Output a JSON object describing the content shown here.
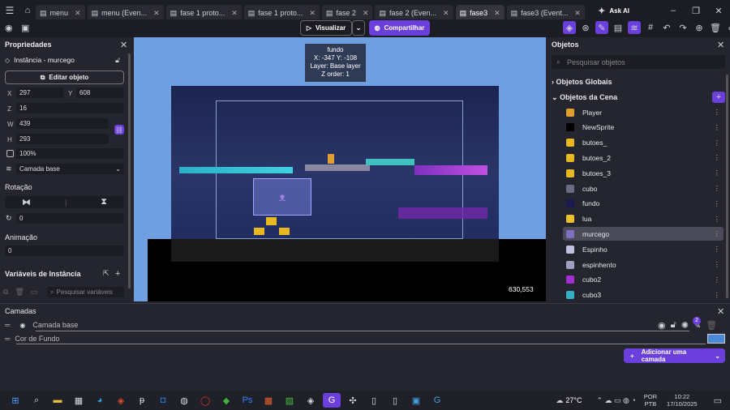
{
  "tabs": [
    {
      "label": "menu"
    },
    {
      "label": "menu (Even..."
    },
    {
      "label": "fase 1 proto..."
    },
    {
      "label": "fase 1 proto..."
    },
    {
      "label": "fase 2"
    },
    {
      "label": "fase 2 (Even..."
    },
    {
      "label": "fase3",
      "active": true
    },
    {
      "label": "fase3 (Event..."
    }
  ],
  "toolbar": {
    "preview_label": "Visualizar",
    "share_label": "Compartilhar",
    "ask_ai_label": "Ask AI"
  },
  "properties": {
    "title": "Propriedades",
    "instance_label": "Instância - murcego",
    "edit_object_label": "Editar objeto",
    "x_label": "X",
    "x": "297",
    "y_label": "Y",
    "y": "608",
    "z_label": "Z",
    "z": "16",
    "w_label": "W",
    "w": "439",
    "h_label": "H",
    "h": "293",
    "opacity": "100%",
    "layer": "Camada base",
    "rotation_label": "Rotação",
    "rotation": "0",
    "animation_label": "Animação",
    "animation": "0",
    "variables_label": "Variáveis de Instância",
    "search_vars_placeholder": "Pesquisar variáveis"
  },
  "canvas": {
    "tooltip": {
      "name": "fundo",
      "coords": "X: -347  Y: -108",
      "layer": "Layer: Base layer",
      "zorder": "Z order: 1"
    },
    "cursor_coords": "630,553"
  },
  "objects": {
    "title": "Objetos",
    "search_placeholder": "Pesquisar objetos",
    "global_label": "Objetos Globais",
    "scene_label": "Objetos da Cena",
    "items": [
      {
        "name": "Player",
        "color": "#e0a030"
      },
      {
        "name": "NewSprite",
        "color": "#000000"
      },
      {
        "name": "butoes_",
        "color": "#e8b820"
      },
      {
        "name": "butoes_2",
        "color": "#e8b820"
      },
      {
        "name": "butoes_3",
        "color": "#e8b820"
      },
      {
        "name": "cubo",
        "color": "#6a6a80"
      },
      {
        "name": "fundo",
        "color": "#1a1a50"
      },
      {
        "name": "lua",
        "color": "#e8c030"
      },
      {
        "name": "murcego",
        "color": "#8070c0",
        "selected": true
      },
      {
        "name": "Espinho",
        "color": "#c0c0e0"
      },
      {
        "name": "espinhento",
        "color": "#a0a0c0"
      },
      {
        "name": "cubo2",
        "color": "#a030d0"
      },
      {
        "name": "cubo3",
        "color": "#30b0c0"
      }
    ]
  },
  "layers": {
    "title": "Camadas",
    "items": [
      {
        "name": "Camada base"
      },
      {
        "name": "Cor de Fundo"
      }
    ],
    "badge": "2",
    "add_layer_label": "Adicionar uma camada",
    "bg_color": "#4a88d8"
  },
  "taskbar": {
    "weather": "27°C",
    "lang1": "POR",
    "lang2": "PTB",
    "time": "10:22",
    "date": "17/10/2025"
  }
}
